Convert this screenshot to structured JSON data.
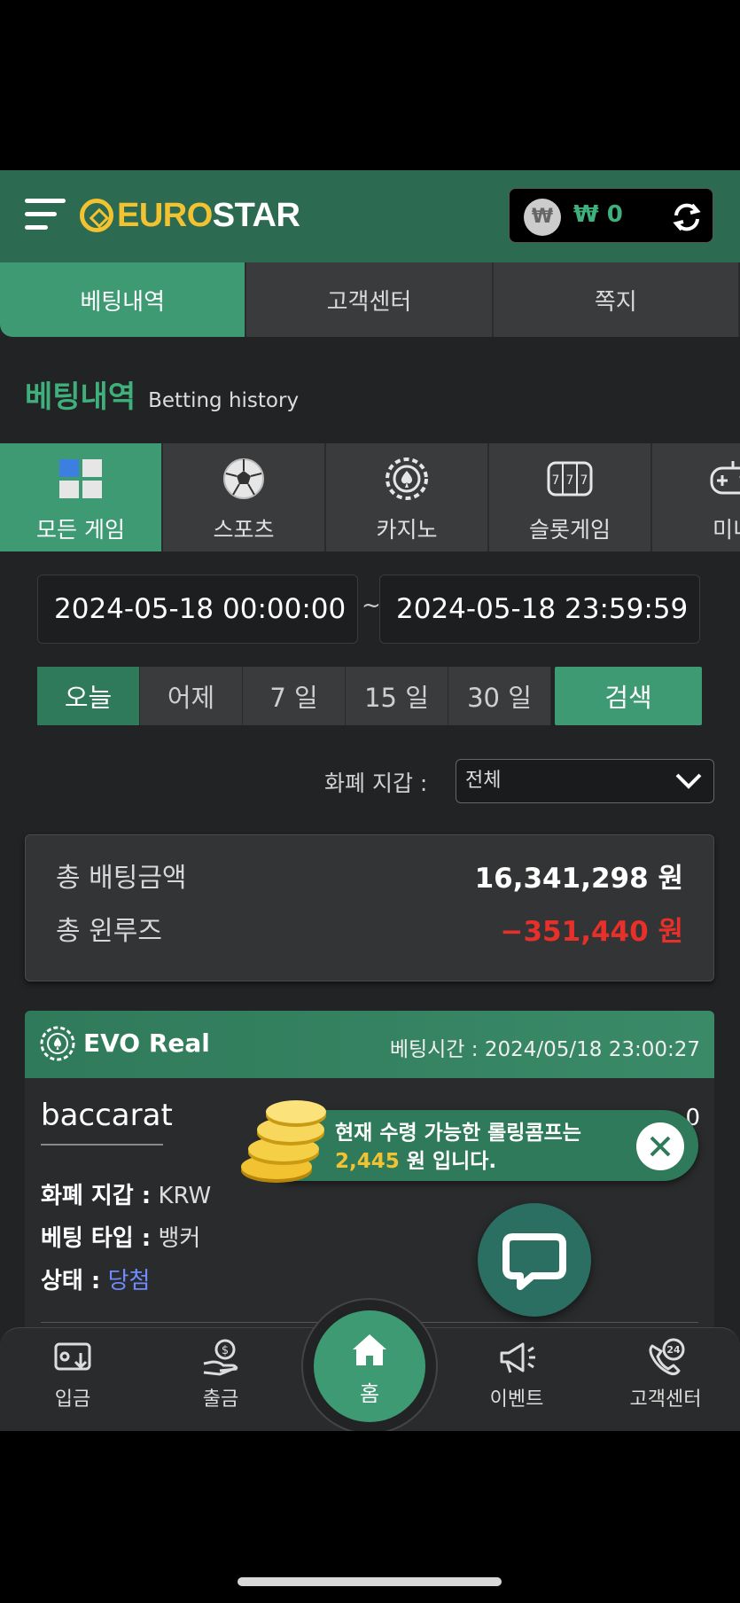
{
  "header": {
    "logo_euro": "EURO",
    "logo_star": "STAR",
    "wallet_currency_symbol": "₩",
    "wallet_amount": "₩ 0"
  },
  "top_tabs": [
    {
      "label": "베팅내역",
      "active": true
    },
    {
      "label": "고객센터",
      "active": false
    },
    {
      "label": "쪽지",
      "active": false
    }
  ],
  "section": {
    "title_ko": "베팅내역",
    "title_en": "Betting history"
  },
  "categories": [
    {
      "label": "모든 게임",
      "icon": "all-games-icon",
      "active": true
    },
    {
      "label": "스포츠",
      "icon": "soccer-ball-icon",
      "active": false
    },
    {
      "label": "카지노",
      "icon": "casino-chip-icon",
      "active": false
    },
    {
      "label": "슬롯게임",
      "icon": "slot-machine-icon",
      "active": false
    },
    {
      "label": "미니",
      "icon": "gamepad-icon",
      "active": false
    }
  ],
  "dates": {
    "start": "2024-05-18 00:00:00",
    "end": "2024-05-18 23:59:59",
    "separator": "~"
  },
  "quick_dates": [
    {
      "label": "오늘",
      "active": true
    },
    {
      "label": "어제",
      "active": false
    },
    {
      "label": "7 일",
      "active": false
    },
    {
      "label": "15 일",
      "active": false
    },
    {
      "label": "30 일",
      "active": false
    }
  ],
  "search_label": "검색",
  "wallet_filter": {
    "label": "화폐 지갑 :",
    "selected": "전체"
  },
  "summary": {
    "total_bet_label": "총 배팅금액",
    "total_bet_value": "16,341,298 원",
    "total_winloss_label": "총 윈루즈",
    "total_winloss_value": "−351,440 원"
  },
  "bet_card": {
    "provider": "EVO Real",
    "time_label": "베팅시간 : 2024/05/18 23:00:27",
    "game": "baccarat",
    "right_partial": "0",
    "wallet_label": "화폐 지갑 :",
    "wallet_value": "KRW",
    "bet_type_label": "베팅 타입 :",
    "bet_type_value": "뱅커",
    "status_label": "상태 :",
    "status_value": "당첨"
  },
  "toast": {
    "line1": "현재 수령 가능한 롤링콤프는",
    "amount": "2,445",
    "line2_suffix": "원 입니다."
  },
  "bottom_nav": [
    {
      "label": "입금",
      "icon": "deposit-icon"
    },
    {
      "label": "출금",
      "icon": "withdraw-icon"
    },
    {
      "label": "홈",
      "icon": "home-icon"
    },
    {
      "label": "이벤트",
      "icon": "megaphone-icon"
    },
    {
      "label": "고객센터",
      "icon": "support-24-icon"
    }
  ],
  "colors": {
    "brand_green": "#3d9a73",
    "header_green": "#2c6b52",
    "gold": "#f2c230",
    "negative_red": "#e8302a",
    "win_blue": "#6f8cff"
  }
}
